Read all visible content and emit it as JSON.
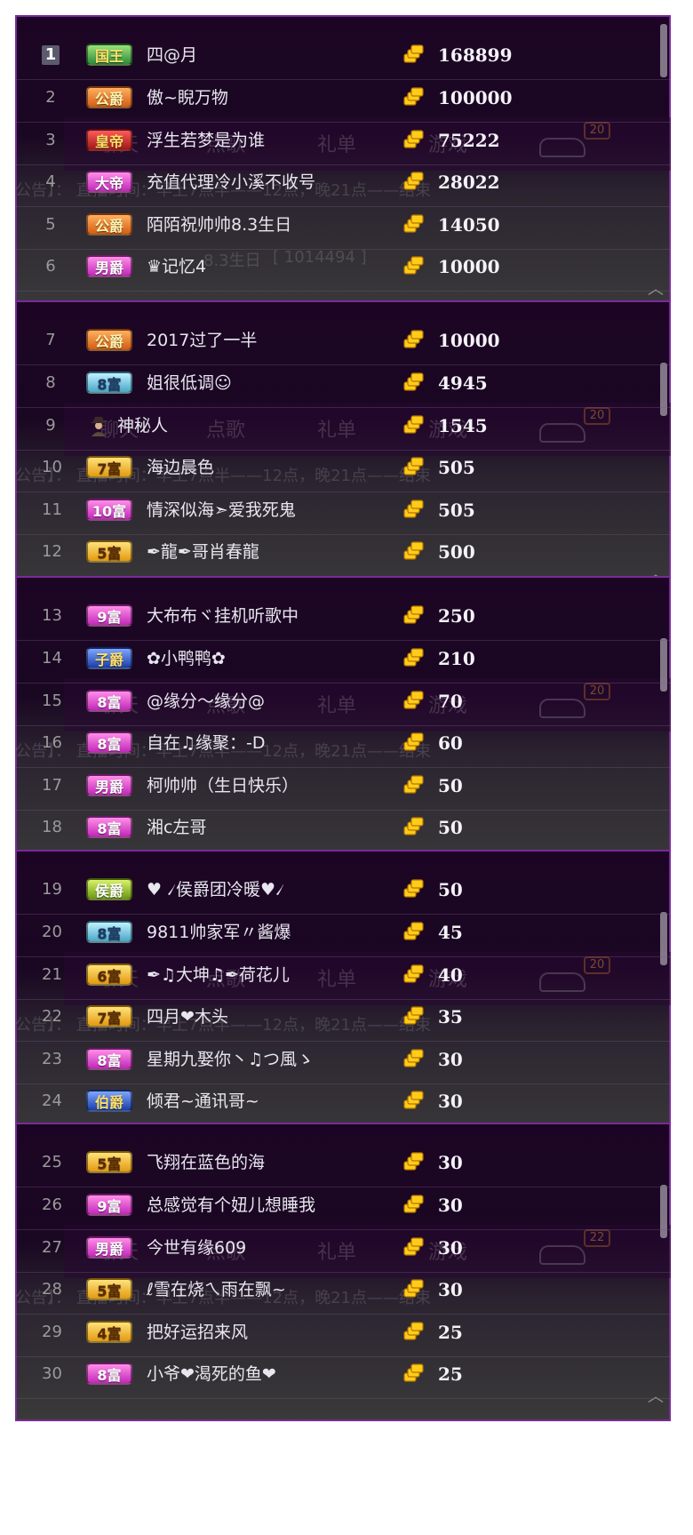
{
  "background_text": {
    "tabs": [
      "聊天",
      "点歌",
      "礼单",
      "游戏"
    ],
    "notice": "公告】：     直播时间：早上7点半——12点，晚21点——结束",
    "bottom_fragment_1": "8.3生日",
    "bottom_fragment_2": "[ 1014494 ]",
    "car_badge_values": [
      "20",
      "20",
      "20",
      "20",
      "22"
    ]
  },
  "panels": [
    {
      "rows": [
        {
          "rank": "1",
          "title": "国王",
          "title_style": "green",
          "name": "四@月",
          "score": "168899"
        },
        {
          "rank": "2",
          "title": "公爵",
          "title_style": "orange",
          "name": "傲~睨万物",
          "score": "100000"
        },
        {
          "rank": "3",
          "title": "皇帝",
          "title_style": "red",
          "name": "浮生若梦是为谁",
          "score": "75222"
        },
        {
          "rank": "4",
          "title": "大帝",
          "title_style": "pink",
          "name": "充值代理冷小溪不收号",
          "score": "28022"
        },
        {
          "rank": "5",
          "title": "公爵",
          "title_style": "orange",
          "name": "陌陌祝帅帅8.3生日",
          "score": "14050"
        },
        {
          "rank": "6",
          "title": "男爵",
          "title_style": "pink",
          "name": "♛记忆4",
          "score": "10000"
        }
      ]
    },
    {
      "rows": [
        {
          "rank": "7",
          "title": "公爵",
          "title_style": "orange",
          "name": "2017过了一半",
          "score": "10000"
        },
        {
          "rank": "8",
          "title": "8富",
          "title_style": "teal",
          "name": "姐很低调☺",
          "score": "4945"
        },
        {
          "rank": "9",
          "title": "",
          "title_style": "mystery",
          "name": "神秘人",
          "score": "1545"
        },
        {
          "rank": "10",
          "title": "7富",
          "title_style": "yellow",
          "name": "海边晨色",
          "score": "505"
        },
        {
          "rank": "11",
          "title": "10富",
          "title_style": "pink",
          "name": "情深似海➣爱我死鬼",
          "score": "505"
        },
        {
          "rank": "12",
          "title": "5富",
          "title_style": "yellow",
          "name": "✒龍✒哥肖春龍",
          "score": "500"
        }
      ]
    },
    {
      "rows": [
        {
          "rank": "13",
          "title": "9富",
          "title_style": "pink",
          "name": "大布布ヾ挂机听歌中",
          "score": "250"
        },
        {
          "rank": "14",
          "title": "子爵",
          "title_style": "blue",
          "name": "✿小鸭鸭✿",
          "score": "210"
        },
        {
          "rank": "15",
          "title": "8富",
          "title_style": "pink",
          "name": "@缘分～缘分@",
          "score": "70"
        },
        {
          "rank": "16",
          "title": "8富",
          "title_style": "pink",
          "name": "自在♫缘聚：-D",
          "score": "60"
        },
        {
          "rank": "17",
          "title": "男爵",
          "title_style": "pink",
          "name": "柯帅帅（生日快乐）",
          "score": "50"
        },
        {
          "rank": "18",
          "title": "8富",
          "title_style": "pink",
          "name": "湘c左哥",
          "score": "50"
        }
      ]
    },
    {
      "rows": [
        {
          "rank": "19",
          "title": "侯爵",
          "title_style": "lime",
          "name": "♥ ৴侯爵团冷暖♥৴",
          "score": "50"
        },
        {
          "rank": "20",
          "title": "8富",
          "title_style": "teal",
          "name": "9811帅家军〃酱爆",
          "score": "45"
        },
        {
          "rank": "21",
          "title": "6富",
          "title_style": "yellow",
          "name": "✒♫大坤♫✒荷花儿",
          "score": "40"
        },
        {
          "rank": "22",
          "title": "7富",
          "title_style": "yellow",
          "name": "四月❤木头",
          "score": "35"
        },
        {
          "rank": "23",
          "title": "8富",
          "title_style": "pink",
          "name": "星期九娶你丶♫つ風ゝ",
          "score": "30"
        },
        {
          "rank": "24",
          "title": "伯爵",
          "title_style": "blue",
          "name": "倾君~通讯哥~",
          "score": "30"
        }
      ]
    },
    {
      "rows": [
        {
          "rank": "25",
          "title": "5富",
          "title_style": "yellow",
          "name": "飞翔在蓝色的海",
          "score": "30"
        },
        {
          "rank": "26",
          "title": "9富",
          "title_style": "pink",
          "name": "总感觉有个妞儿想睡我",
          "score": "30"
        },
        {
          "rank": "27",
          "title": "男爵",
          "title_style": "pink",
          "name": "今世有缘609",
          "score": "30"
        },
        {
          "rank": "28",
          "title": "5富",
          "title_style": "yellow",
          "name": "ℓ雪在烧ㄟ雨在飘~",
          "score": "30"
        },
        {
          "rank": "29",
          "title": "4富",
          "title_style": "yellow",
          "name": "把好运招来风",
          "score": "25"
        },
        {
          "rank": "30",
          "title": "8富",
          "title_style": "pink",
          "name": "小爷❤渴死的鱼❤",
          "score": "25"
        }
      ]
    }
  ],
  "icons": {
    "coin": "gold-coin-icon",
    "mystery": "mystery-person-icon",
    "scroll_up": "chevron-up-icon"
  },
  "colors": {
    "panel_top": "#1c0524",
    "panel_bottom": "#3a3a3a",
    "border": "#7a2a99",
    "text": "#e8e6ef"
  }
}
